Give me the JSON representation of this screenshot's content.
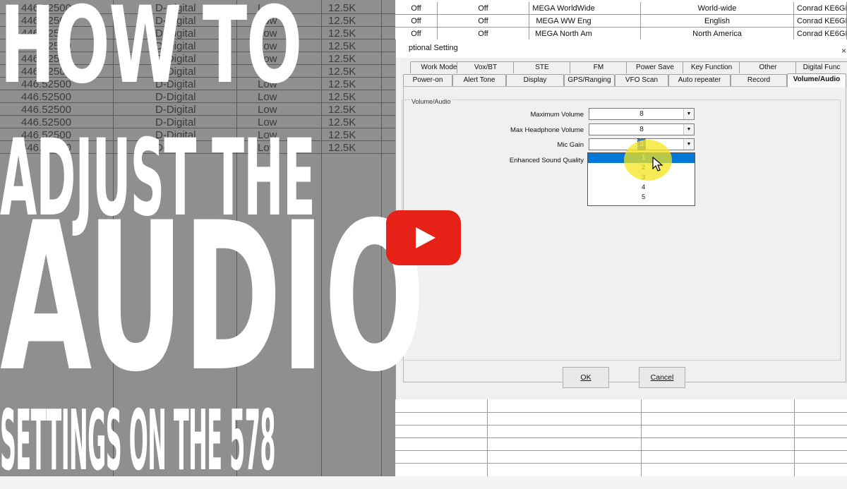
{
  "title": {
    "lines": [
      "HOW TO",
      "ADJUST THE",
      "AUDIO",
      "SETTINGS ON THE 578"
    ]
  },
  "background_sheet": {
    "left_rows": [
      [
        "446.52500",
        "D-Digital",
        "Low",
        "12.5K"
      ],
      [
        "446.52500",
        "D-Digital",
        "Low",
        "12.5K"
      ],
      [
        "446.52500",
        "D-Digital",
        "Low",
        "12.5K"
      ],
      [
        "446.52500",
        "D-Digital",
        "Low",
        "12.5K"
      ],
      [
        "446.52500",
        "D-Digital",
        "Low",
        "12.5K"
      ],
      [
        "446.52500",
        "D-Digital",
        "Low",
        "12.5K"
      ],
      [
        "446.52500",
        "D-Digital",
        "Low",
        "12.5K"
      ],
      [
        "446.52500",
        "D-Digital",
        "Low",
        "12.5K"
      ],
      [
        "446.52500",
        "D-Digital",
        "Low",
        "12.5K"
      ],
      [
        "446.52500",
        "D-Digital",
        "Low",
        "12.5K"
      ],
      [
        "446.52500",
        "D-Digital",
        "Low",
        "12.5K"
      ],
      [
        "446.52500",
        "D-Digital",
        "Low",
        "12.5K"
      ]
    ],
    "top_rows": [
      [
        "Off",
        "Off",
        "MEGA WorldWide",
        "World-wide",
        "Conrad KE6GF"
      ],
      [
        "Off",
        "Off",
        "MEGA WW Eng",
        "English",
        "Conrad KE6GF"
      ],
      [
        "Off",
        "Off",
        "MEGA North Am",
        "North America",
        "Conrad KE6GF"
      ]
    ]
  },
  "dialog": {
    "title": "ptional Setting",
    "close": "×",
    "tabs_row1": [
      "Work Mode",
      "Vox/BT",
      "STE",
      "FM",
      "Power Save",
      "Key Function",
      "Other",
      "Digital Func"
    ],
    "tabs_row2": [
      "Power-on",
      "Alert Tone",
      "Display",
      "GPS/Ranging",
      "VFO Scan",
      "Auto repeater",
      "Record",
      "Volume/Audio"
    ],
    "active_tab": "Volume/Audio",
    "group_label": "Volume/Audio",
    "fields": [
      {
        "label": "Maximum Volume",
        "value": "8"
      },
      {
        "label": "Max Headphone Volume",
        "value": "8"
      },
      {
        "label": "Mic Gain",
        "value": "3"
      },
      {
        "label": "Enhanced Sound Quality",
        "value": ""
      }
    ],
    "dropdown_options": [
      "1",
      "2",
      "3",
      "4",
      "5"
    ],
    "dropdown_selected": "1",
    "ok_label": "OK",
    "cancel_label": "Cancel"
  },
  "colors": {
    "play_button": "#e62117",
    "selection": "#0078d7",
    "highlight": "#f5e61e"
  }
}
